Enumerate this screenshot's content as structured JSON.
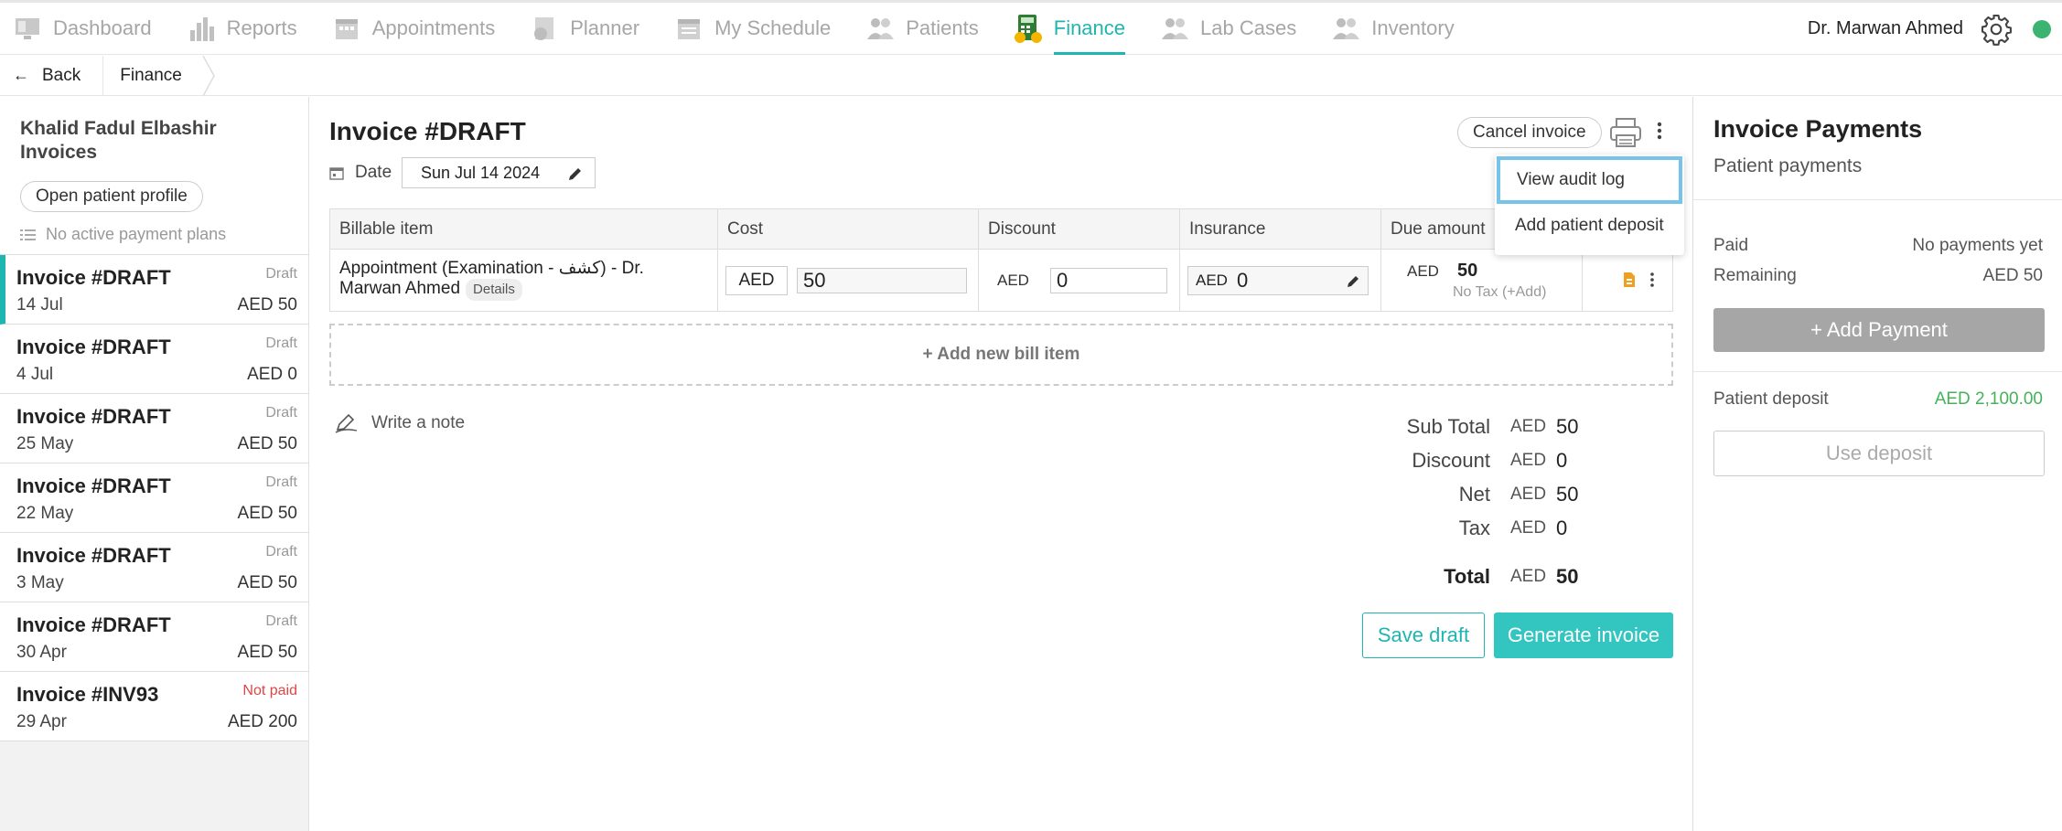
{
  "nav": {
    "items": [
      {
        "label": "Dashboard",
        "icon": "dashboard-icon"
      },
      {
        "label": "Reports",
        "icon": "reports-icon"
      },
      {
        "label": "Appointments",
        "icon": "appointments-icon"
      },
      {
        "label": "Planner",
        "icon": "planner-icon"
      },
      {
        "label": "My Schedule",
        "icon": "schedule-icon"
      },
      {
        "label": "Patients",
        "icon": "patients-icon"
      },
      {
        "label": "Finance",
        "icon": "finance-icon",
        "active": true
      },
      {
        "label": "Lab Cases",
        "icon": "lab-cases-icon"
      },
      {
        "label": "Inventory",
        "icon": "inventory-icon"
      }
    ],
    "user_name": "Dr. Marwan Ahmed",
    "accent": "#1fb5b0",
    "status_color": "#3cb371"
  },
  "breadcrumb": {
    "back": "Back",
    "current": "Finance"
  },
  "sidebar": {
    "patient_name": "Khalid Fadul Elbashir",
    "section_title": "Invoices",
    "open_profile": "Open patient profile",
    "no_plans": "No active payment plans",
    "invoices": [
      {
        "title": "Invoice #DRAFT",
        "status": "Draft",
        "date": "14 Jul",
        "amount": "AED 50",
        "selected": true
      },
      {
        "title": "Invoice #DRAFT",
        "status": "Draft",
        "date": "4 Jul",
        "amount": "AED 0"
      },
      {
        "title": "Invoice #DRAFT",
        "status": "Draft",
        "date": "25 May",
        "amount": "AED 50"
      },
      {
        "title": "Invoice #DRAFT",
        "status": "Draft",
        "date": "22 May",
        "amount": "AED 50"
      },
      {
        "title": "Invoice #DRAFT",
        "status": "Draft",
        "date": "3 May",
        "amount": "AED 50"
      },
      {
        "title": "Invoice #DRAFT",
        "status": "Draft",
        "date": "30 Apr",
        "amount": "AED 50"
      },
      {
        "title": "Invoice #INV93",
        "status": "Not paid",
        "date": "29 Apr",
        "amount": "AED 200"
      }
    ]
  },
  "main": {
    "title": "Invoice #DRAFT",
    "date_label": "Date",
    "date_value": "Sun Jul 14 2024",
    "cancel_invoice": "Cancel invoice",
    "menu": {
      "view_audit_log": "View audit log",
      "add_patient_deposit": "Add patient deposit"
    },
    "table": {
      "headers": [
        "Billable item",
        "Cost",
        "Discount",
        "Insurance",
        "Due amount"
      ],
      "row": {
        "item": "Appointment (Examination - كشف) - Dr. Marwan Ahmed",
        "details": "Details",
        "cost_currency": "AED",
        "cost_value": "50",
        "discount_currency": "AED",
        "discount_value": "0",
        "insurance_currency": "AED",
        "insurance_value": "0",
        "due_currency": "AED",
        "due_value": "50",
        "tax_note": "No Tax (+Add)"
      }
    },
    "add_bill_item": "+ Add new bill item",
    "write_note": "Write a note",
    "totals": [
      {
        "label": "Sub Total",
        "currency": "AED",
        "value": "50"
      },
      {
        "label": "Discount",
        "currency": "AED",
        "value": "0"
      },
      {
        "label": "Net",
        "currency": "AED",
        "value": "50"
      },
      {
        "label": "Tax",
        "currency": "AED",
        "value": "0"
      }
    ],
    "total": {
      "label": "Total",
      "currency": "AED",
      "value": "50"
    },
    "save_draft": "Save draft",
    "generate_invoice": "Generate invoice"
  },
  "payments": {
    "title": "Invoice Payments",
    "subtitle": "Patient payments",
    "paid_label": "Paid",
    "paid_value": "No payments yet",
    "remaining_label": "Remaining",
    "remaining_value": "AED 50",
    "add_payment": "+ Add Payment",
    "deposit_label": "Patient deposit",
    "deposit_value": "AED 2,100.00",
    "use_deposit": "Use deposit"
  }
}
